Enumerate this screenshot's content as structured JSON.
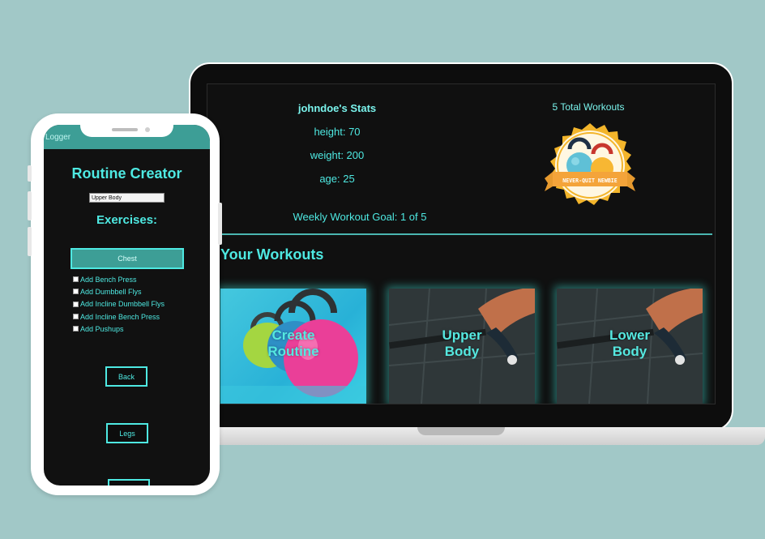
{
  "laptop": {
    "stats": {
      "title": "johndoe's Stats",
      "height": "height: 70",
      "weight": "weight: 200",
      "age": "age: 25",
      "goal": "Weekly Workout Goal: 1 of 5"
    },
    "total_workouts": "5 Total Workouts",
    "badge": {
      "text": "NEVER-QUIT NEWBIE",
      "icon": "kettlebells-badge-icon"
    },
    "workouts_title": "Your Workouts",
    "cards": [
      {
        "line1": "Create",
        "line2": "Routine"
      },
      {
        "line1": "Upper",
        "line2": "Body"
      },
      {
        "line1": "Lower",
        "line2": "Body"
      }
    ]
  },
  "phone": {
    "header": "Logger",
    "title": "Routine Creator",
    "routine_value": "Upper Body",
    "exercises_title": "Exercises:",
    "chest_label": "Chest",
    "exercises": [
      "Add Bench Press",
      "Add Dumbbell Flys",
      "Add Incline Dumbbell Flys",
      "Add Incline Bench Press",
      "Add Pushups"
    ],
    "back_label": "Back",
    "legs_label": "Legs"
  },
  "colors": {
    "background": "#a1c8c7",
    "accent": "#4ee9e2",
    "header_teal": "#3d9e96",
    "dark": "#101010"
  }
}
